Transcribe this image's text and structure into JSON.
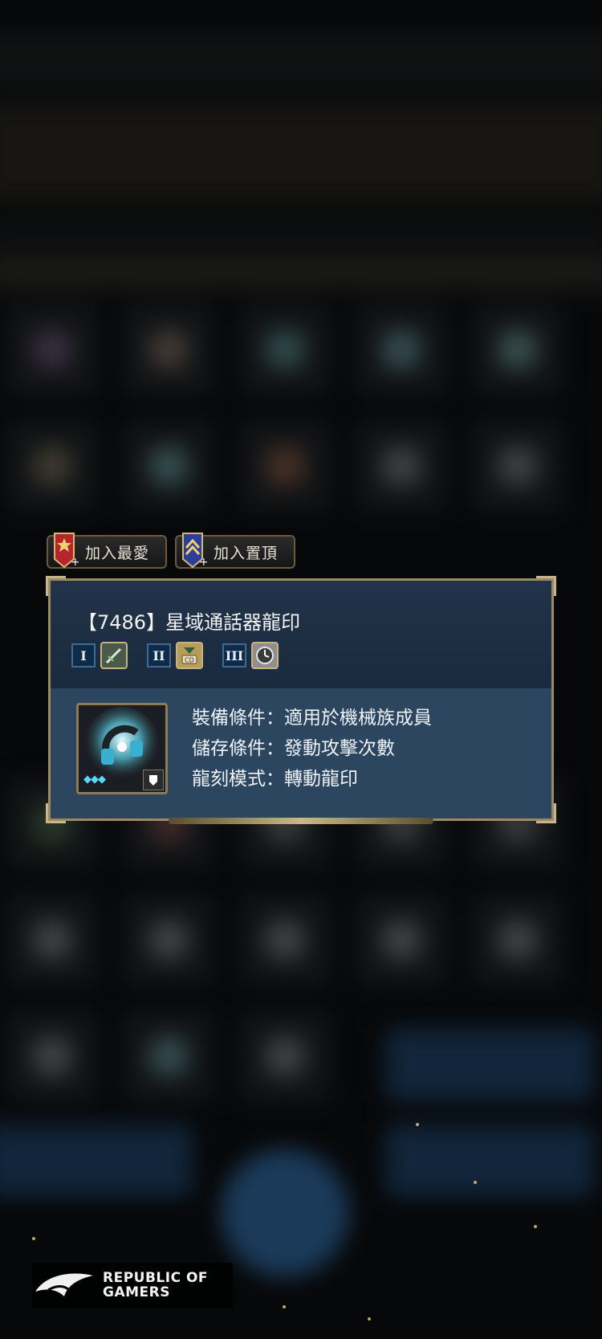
{
  "buttons": {
    "favorite": "加入最愛",
    "pin_top": "加入置頂"
  },
  "item": {
    "title": "【7486】星域通話器龍印",
    "skills": [
      {
        "rank": "I",
        "icon": "sword-icon"
      },
      {
        "rank": "II",
        "icon": "cd-hourglass-icon"
      },
      {
        "rank": "III",
        "icon": "clock-icon"
      }
    ],
    "conditions": [
      {
        "label": "裝備條件",
        "value": "適用於機械族成員"
      },
      {
        "label": "儲存條件",
        "value": "發動攻擊次數"
      },
      {
        "label": "龍刻模式",
        "value": "轉動龍印"
      }
    ],
    "gems": "◆◆◆"
  },
  "logo": {
    "line1": "REPUBLIC OF",
    "line2": "GAMERS"
  },
  "colors": {
    "panel_head": "#1a2a3e",
    "panel_body": "#2d4660",
    "gold_trim": "#9c8a63",
    "gem": "#59d8ff"
  }
}
